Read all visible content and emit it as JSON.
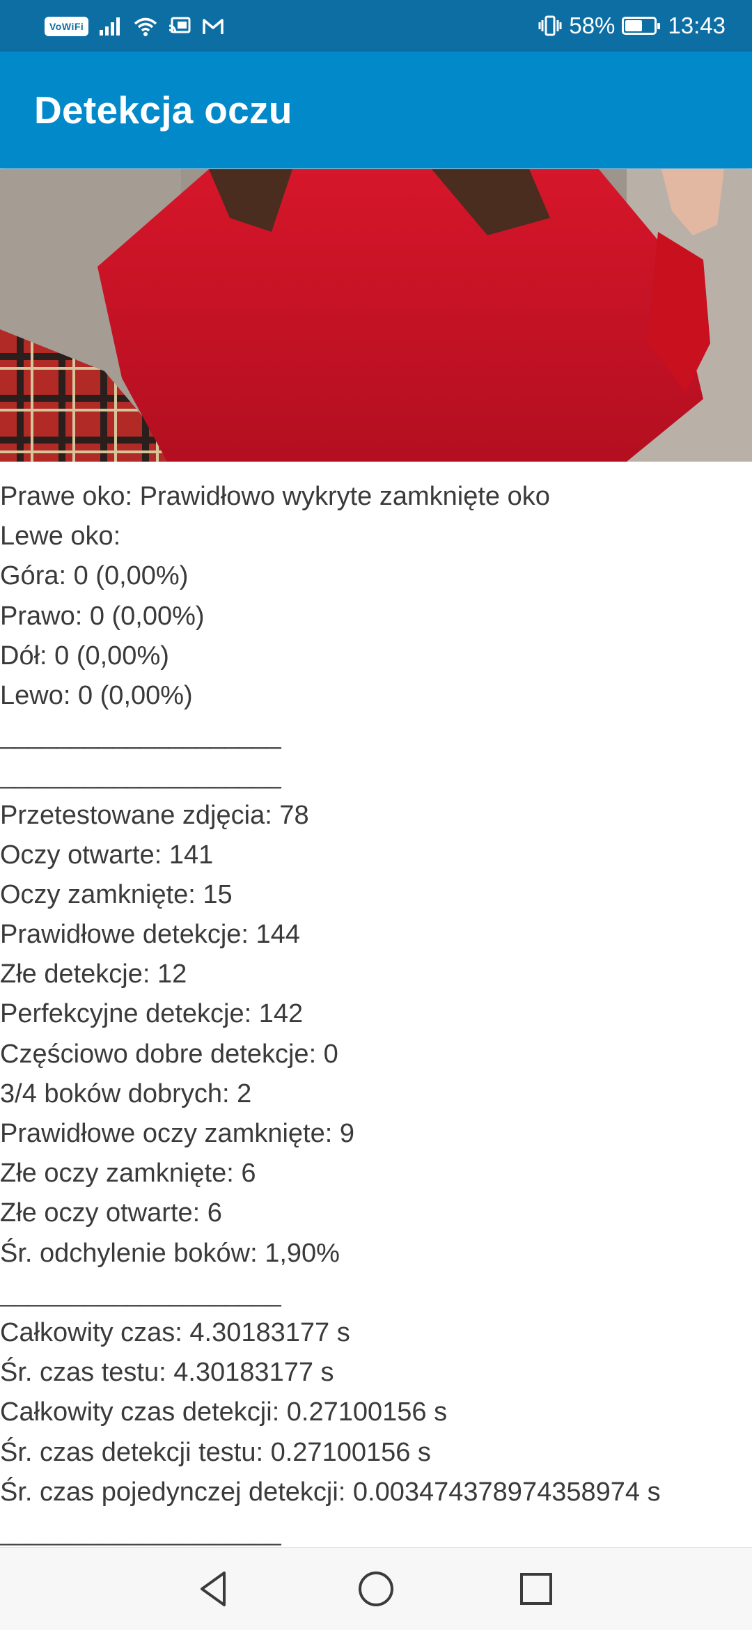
{
  "status_bar": {
    "vowifi": "VoWiFi",
    "battery_percent": "58%",
    "battery_level": 0.58,
    "time": "13:43",
    "icons": [
      "signal-icon",
      "wifi-icon",
      "cast-icon",
      "gmail-icon",
      "vibrate-icon",
      "battery-icon"
    ]
  },
  "app_bar": {
    "title": "Detekcja oczu"
  },
  "photo": {
    "description_icon": "photo-image"
  },
  "results": {
    "lines": [
      "Prawe oko: Prawidłowo wykryte zamknięte oko",
      "Lewe oko:",
      "Góra: 0 (0,00%)",
      "Prawo: 0 (0,00%)",
      "Dół: 0 (0,00%)",
      "Lewo: 0 (0,00%)",
      "____________________",
      "____________________",
      "Przetestowane zdjęcia: 78",
      "Oczy otwarte: 141",
      "Oczy zamknięte: 15",
      "Prawidłowe detekcje: 144",
      "Złe detekcje: 12",
      "Perfekcyjne detekcje: 142",
      "Częściowo dobre detekcje: 0",
      "3/4 boków dobrych: 2",
      "Prawidłowe oczy zamknięte: 9",
      "Złe oczy zamknięte: 6",
      "Złe oczy otwarte: 6",
      "Śr. odchylenie boków: 1,90%",
      "____________________",
      "Całkowity czas: 4.30183177 s",
      "Śr. czas testu: 4.30183177 s",
      "Całkowity czas detekcji: 0.27100156 s",
      "Śr. czas detekcji testu: 0.27100156 s",
      "Śr. czas pojedynczej detekcji: 0.003474378974358974 s",
      "____________________"
    ]
  },
  "nav_bar": {
    "icons": [
      "back-icon",
      "home-icon",
      "recents-icon"
    ]
  }
}
